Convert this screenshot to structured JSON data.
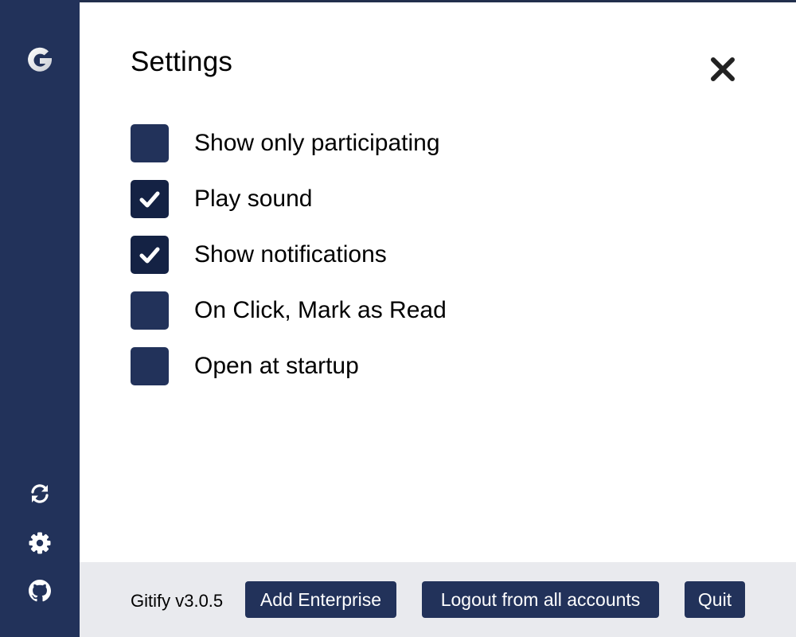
{
  "settings": {
    "title": "Settings",
    "options": [
      {
        "label": "Show only participating",
        "checked": false
      },
      {
        "label": "Play sound",
        "checked": true
      },
      {
        "label": "Show notifications",
        "checked": true
      },
      {
        "label": "On Click, Mark as Read",
        "checked": false
      },
      {
        "label": "Open at startup",
        "checked": false
      }
    ]
  },
  "sidebar": {
    "logo_icon": "gitify-logo-icon",
    "items": [
      {
        "icon": "refresh-icon"
      },
      {
        "icon": "gear-icon"
      },
      {
        "icon": "github-icon"
      }
    ]
  },
  "footer": {
    "version": "Gitify v3.0.5",
    "add_enterprise_label": "Add Enterprise",
    "logout_label": "Logout from all accounts",
    "quit_label": "Quit"
  },
  "colors": {
    "sidebar": "#22325a",
    "checkbox": "#22325a",
    "checkbox_checked": "#142244",
    "footer_bg": "#e9eaee",
    "button_bg": "#22325a"
  }
}
